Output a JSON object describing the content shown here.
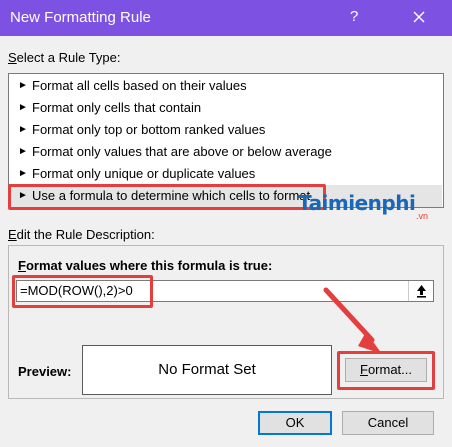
{
  "window": {
    "title": "New Formatting Rule",
    "help": "?",
    "close_icon": "close-icon"
  },
  "rule_type": {
    "label": "Select a Rule Type:",
    "items": [
      {
        "text": "Format all cells based on their values",
        "selected": false
      },
      {
        "text": "Format only cells that contain",
        "selected": false
      },
      {
        "text": "Format only top or bottom ranked values",
        "selected": false
      },
      {
        "text": "Format only values that are above or below average",
        "selected": false
      },
      {
        "text": "Format only unique or duplicate values",
        "selected": false
      },
      {
        "text": "Use a formula to determine which cells to format",
        "selected": true
      }
    ],
    "bullet_icon": "triangle-right-icon"
  },
  "description": {
    "label": "Edit the Rule Description:",
    "formula_label": "Format values where this formula is true:",
    "formula_value": "=MOD(ROW(),2)>0",
    "collapse_icon": "collapse-dialog-icon"
  },
  "preview": {
    "label": "Preview:",
    "text": "No Format Set"
  },
  "buttons": {
    "format": "Format...",
    "ok": "OK",
    "cancel": "Cancel"
  },
  "watermark": {
    "text": "Taimienphi",
    "suffix": ".vn"
  },
  "colors": {
    "titlebar": "#7d52e3",
    "highlight_annotation": "#e43f3f",
    "default_button_border": "#0078d7"
  }
}
